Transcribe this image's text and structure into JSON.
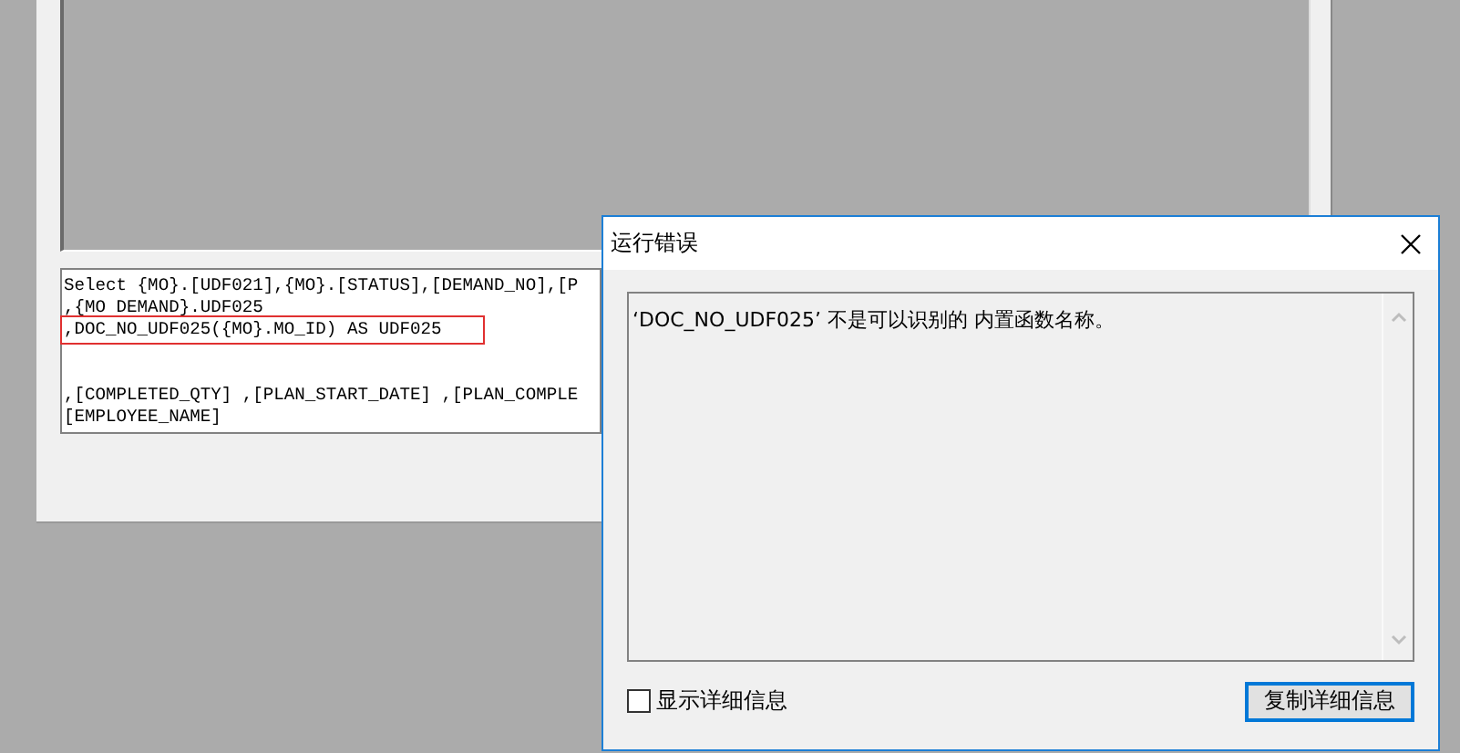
{
  "editor": {
    "sql_lines": [
      {
        "text": "Select {MO}.[UDF021],{MO}.[STATUS],[DEMAND_NO],[P",
        "highlighted": false,
        "gap_before": false
      },
      {
        "text": ",{MO DEMAND}.UDF025",
        "highlighted": false,
        "gap_before": false
      },
      {
        "text": ",DOC_NO_UDF025({MO}.MO_ID) AS UDF025",
        "highlighted": true,
        "gap_before": false
      },
      {
        "text": ",[COMPLETED_QTY] ,[PLAN_START_DATE] ,[PLAN_COMPLE",
        "highlighted": false,
        "gap_before": true
      },
      {
        "text": "[EMPLOYEE_NAME]",
        "highlighted": false,
        "gap_before": false
      }
    ]
  },
  "dialog": {
    "title": "运行错误",
    "message": "‘DOC_NO_UDF025’ 不是可以识别的 内置函数名称。",
    "show_details": {
      "label": "显示详细信息",
      "checked": false
    },
    "buttons": [
      {
        "label": "复制详细信息",
        "focused": true
      }
    ]
  }
}
